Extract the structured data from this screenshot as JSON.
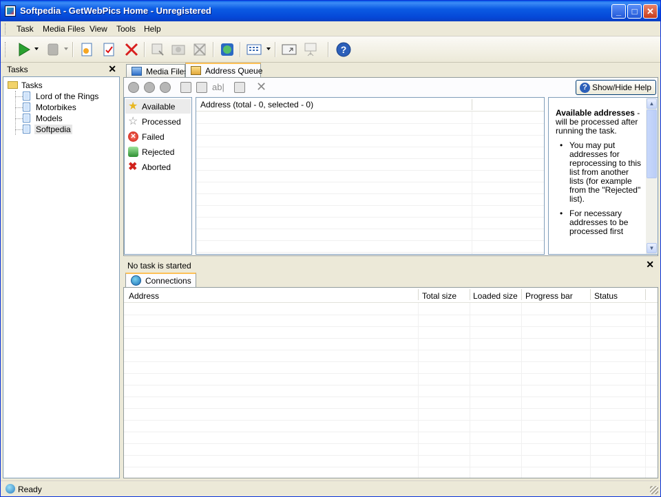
{
  "window": {
    "title": "Softpedia - GetWebPics Home - Unregistered"
  },
  "menu": [
    "Task",
    "Media Files",
    "View",
    "Tools",
    "Help"
  ],
  "toolbar": {
    "icons": [
      "play-icon",
      "stop-icon",
      "new-task-icon",
      "edit-task-icon",
      "delete-icon",
      "scan-icon",
      "capture-icon",
      "filter-icon",
      "browser-icon",
      "view-icon",
      "window-icon",
      "presentation-icon",
      "help-icon"
    ]
  },
  "tasks_panel": {
    "header": "Tasks",
    "root": "Tasks",
    "items": [
      "Lord of the Rings",
      "Motorbikes",
      "Models",
      "Softpedia"
    ],
    "selected": "Softpedia"
  },
  "tabs": [
    "Media Files",
    "Address Queue"
  ],
  "active_tab": "Address Queue",
  "help_button": "Show/Hide Help",
  "status_filters": [
    "Available",
    "Processed",
    "Failed",
    "Rejected",
    "Aborted"
  ],
  "address_table": {
    "header": "Address (total - 0, selected - 0)"
  },
  "help_panel": {
    "title": "Available addresses",
    "intro": " - will be processed after running the task.",
    "bullets": [
      "You may put addresses for reprocessing to this list from another lists (for example from the \"Rejected\" list).",
      "For necessary addresses to be processed first"
    ]
  },
  "bottom": {
    "task_status": "No task is started",
    "tab": "Connections",
    "columns": [
      "Address",
      "Total size",
      "Loaded size",
      "Progress bar",
      "Status"
    ]
  },
  "statusbar": {
    "text": "Ready"
  },
  "colors": {
    "titlebar": "#0548d8",
    "accent_tab": "#fdc056",
    "selection": "#e6e6e6"
  }
}
